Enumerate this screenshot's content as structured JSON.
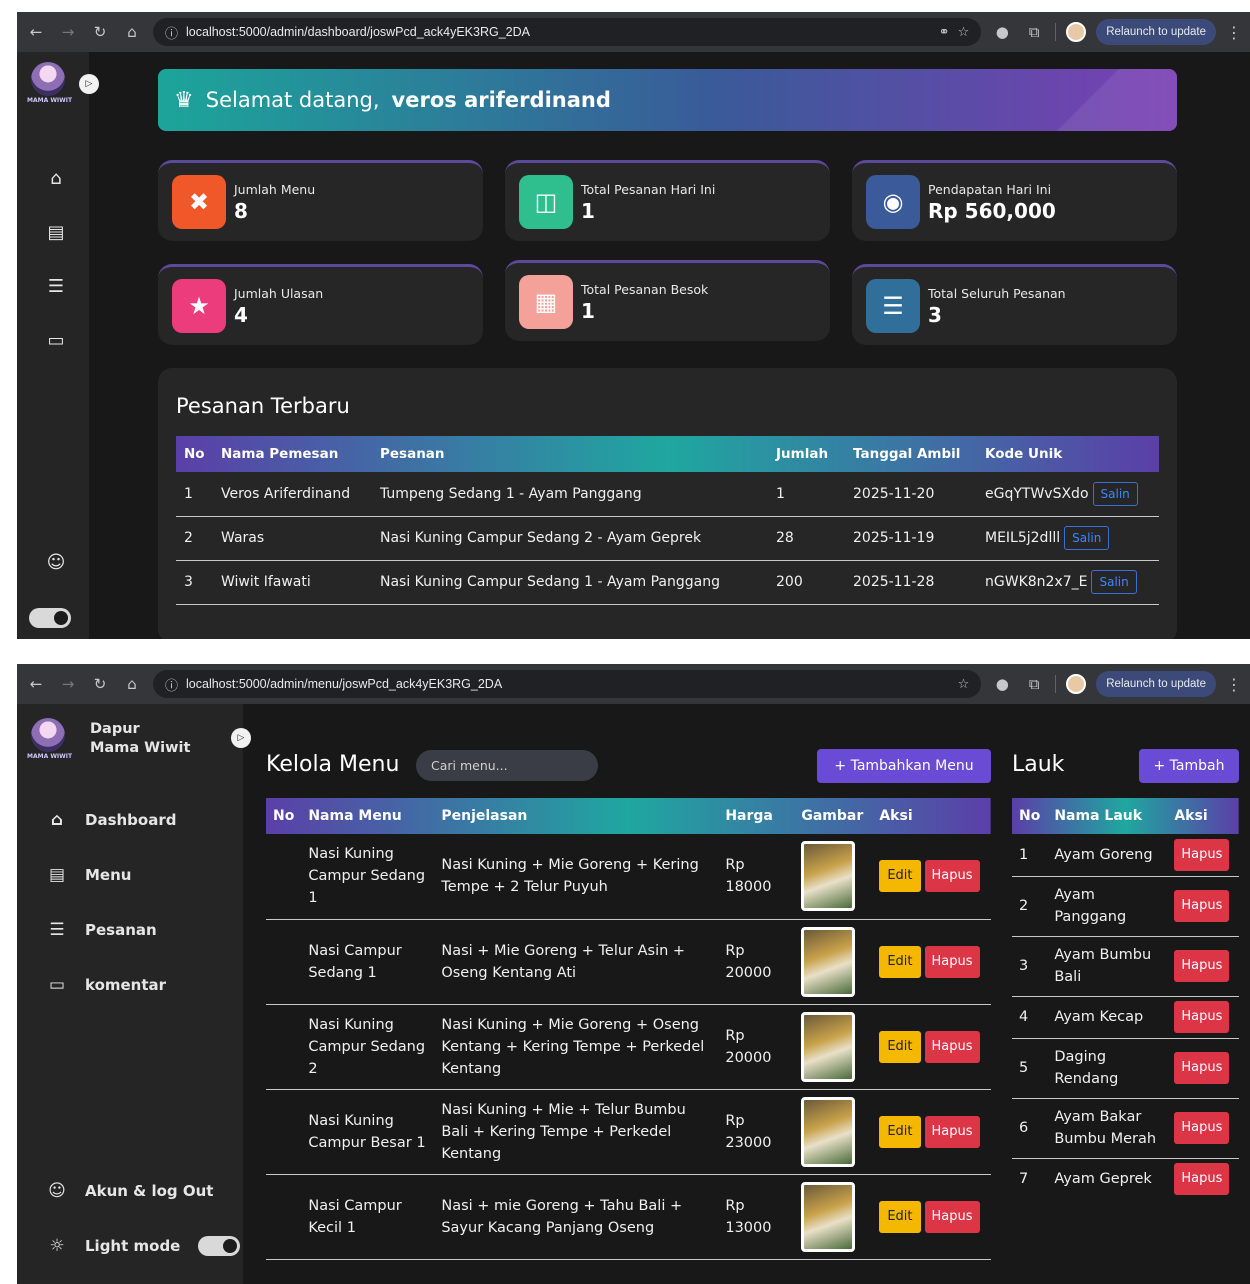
{
  "window1": {
    "url": "localhost:5000/admin/dashboard/joswPcd_ack4yEK3RG_2DA",
    "relaunch": "Relaunch to update",
    "logo_text": "MAMA WIWIT",
    "welcome": {
      "prefix": "Selamat datang,",
      "name": "veros ariferdinand"
    },
    "cards": [
      {
        "label": "Jumlah Menu",
        "value": "8",
        "icon": "utensils-icon",
        "color": "#f0582a"
      },
      {
        "label": "Total Pesanan Hari Ini",
        "value": "1",
        "icon": "cart-icon",
        "color": "#2fbf8f"
      },
      {
        "label": "Pendapatan Hari Ini",
        "value": "Rp 560,000",
        "icon": "money-icon",
        "color": "#3b5a9a"
      },
      {
        "label": "Jumlah Ulasan",
        "value": "4",
        "icon": "star-icon",
        "color": "#ec3c7c"
      },
      {
        "label": "Total Pesanan Besok",
        "value": "1",
        "icon": "calendar-icon",
        "color": "#f4a19a"
      },
      {
        "label": "Total Seluruh Pesanan",
        "value": "3",
        "icon": "list-icon",
        "color": "#2f6f9a"
      }
    ],
    "recent": {
      "title": "Pesanan Terbaru",
      "headers": [
        "No",
        "Nama Pemesan",
        "Pesanan",
        "Jumlah",
        "Tanggal Ambil",
        "Kode Unik"
      ],
      "copy_label": "Salin",
      "rows": [
        {
          "no": "1",
          "name": "Veros Ariferdinand",
          "order": "Tumpeng Sedang 1 - Ayam Panggang",
          "qty": "1",
          "date": "2025-11-20",
          "code": "eGqYTWvSXdo"
        },
        {
          "no": "2",
          "name": "Waras",
          "order": "Nasi Kuning Campur Sedang 2 - Ayam Geprek",
          "qty": "28",
          "date": "2025-11-19",
          "code": "MEIL5j2dlll"
        },
        {
          "no": "3",
          "name": "Wiwit Ifawati",
          "order": "Nasi Kuning Campur Sedang 1 - Ayam Panggang",
          "qty": "200",
          "date": "2025-11-28",
          "code": "nGWK8n2x7_E"
        }
      ]
    }
  },
  "window2": {
    "url": "localhost:5000/admin/menu/joswPcd_ack4yEK3RG_2DA",
    "relaunch": "Relaunch to update",
    "brand": "Dapur\nMama Wiwit",
    "sidebar": [
      "Dashboard",
      "Menu",
      "Pesanan",
      "komentar"
    ],
    "account": "Akun & log Out",
    "light_mode": "Light mode",
    "title": "Kelola Menu",
    "search_placeholder": "Cari menu...",
    "add_menu": "+ Tambahkan Menu",
    "menu_headers": [
      "No",
      "Nama Menu",
      "Penjelasan",
      "Harga",
      "Gambar",
      "Aksi"
    ],
    "edit_label": "Edit",
    "delete_label": "Hapus",
    "menu_rows": [
      {
        "name": "Nasi Kuning Campur Sedang 1",
        "desc": "Nasi Kuning + Mie Goreng + Kering Tempe + 2 Telur Puyuh",
        "price": "Rp 18000"
      },
      {
        "name": "Nasi Campur Sedang 1",
        "desc": "Nasi + Mie Goreng + Telur Asin + Oseng Kentang Ati",
        "price": "Rp 20000"
      },
      {
        "name": "Nasi Kuning Campur Sedang 2",
        "desc": "Nasi Kuning + Mie Goreng + Oseng Kentang + Kering Tempe + Perkedel Kentang",
        "price": "Rp 20000"
      },
      {
        "name": "Nasi Kuning Campur Besar 1",
        "desc": "Nasi Kuning + Mie + Telur Bumbu Bali + Kering Tempe + Perkedel Kentang",
        "price": "Rp 23000"
      },
      {
        "name": "Nasi Campur Kecil 1",
        "desc": "Nasi + mie Goreng + Tahu Bali + Sayur Kacang Panjang Oseng",
        "price": "Rp 13000"
      }
    ],
    "lauk_title": "Lauk",
    "add_lauk": "+ Tambah",
    "lauk_headers": [
      "No",
      "Nama Lauk",
      "Aksi"
    ],
    "lauk_rows": [
      {
        "no": "1",
        "name": "Ayam Goreng"
      },
      {
        "no": "2",
        "name": "Ayam Panggang"
      },
      {
        "no": "3",
        "name": "Ayam Bumbu Bali"
      },
      {
        "no": "4",
        "name": "Ayam Kecap"
      },
      {
        "no": "5",
        "name": "Daging Rendang"
      },
      {
        "no": "6",
        "name": "Ayam Bakar Bumbu Merah"
      },
      {
        "no": "7",
        "name": "Ayam Geprek"
      }
    ]
  }
}
